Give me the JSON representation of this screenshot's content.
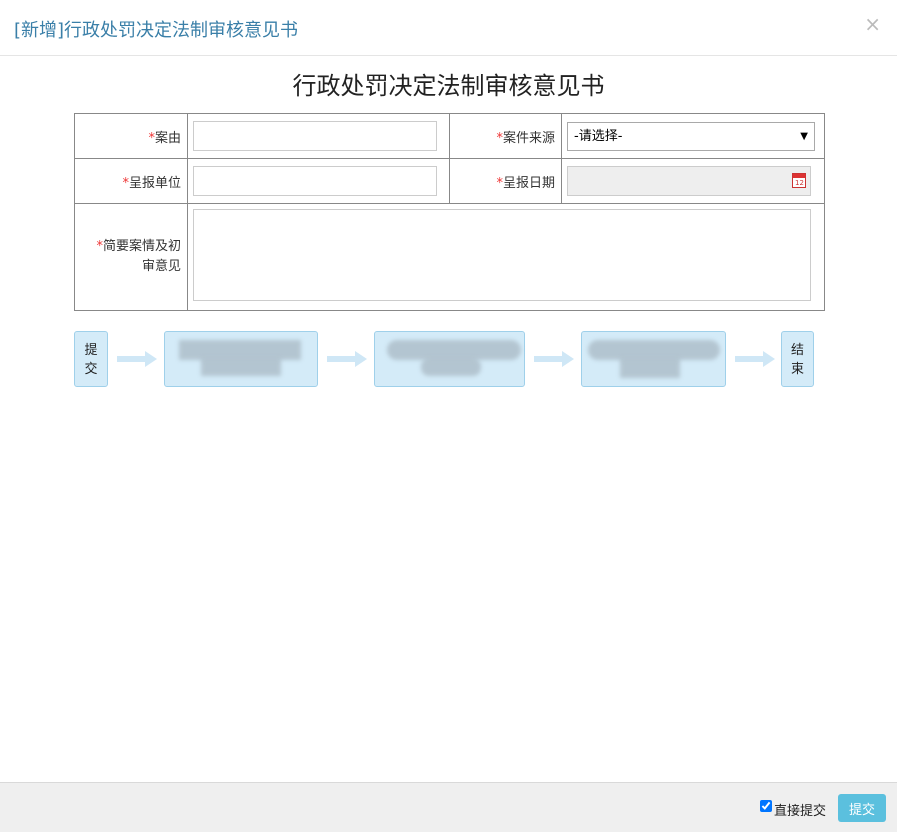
{
  "header": {
    "title": "[新增]行政处罚决定法制审核意见书",
    "close_glyph": "×"
  },
  "doc_title": "行政处罚决定法制审核意见书",
  "required_mark": "*",
  "form": {
    "case_reason": {
      "label": "案由",
      "value": ""
    },
    "case_source": {
      "label": "案件来源",
      "selected": "-请选择-"
    },
    "report_unit": {
      "label": "呈报单位",
      "value": ""
    },
    "report_date": {
      "label": "呈报日期",
      "value": ""
    },
    "summary": {
      "label_line1": "简要案情及初",
      "label_line2": "审意见",
      "value": ""
    }
  },
  "flow": {
    "start_char1": "提",
    "start_char2": "交",
    "end_char1": "结",
    "end_char2": "束",
    "step_color": "#d4ebf8",
    "arrow_color": "#cfe7f6"
  },
  "footer": {
    "direct_submit_label": "直接提交",
    "direct_submit_checked": true,
    "submit_label": "提交"
  }
}
